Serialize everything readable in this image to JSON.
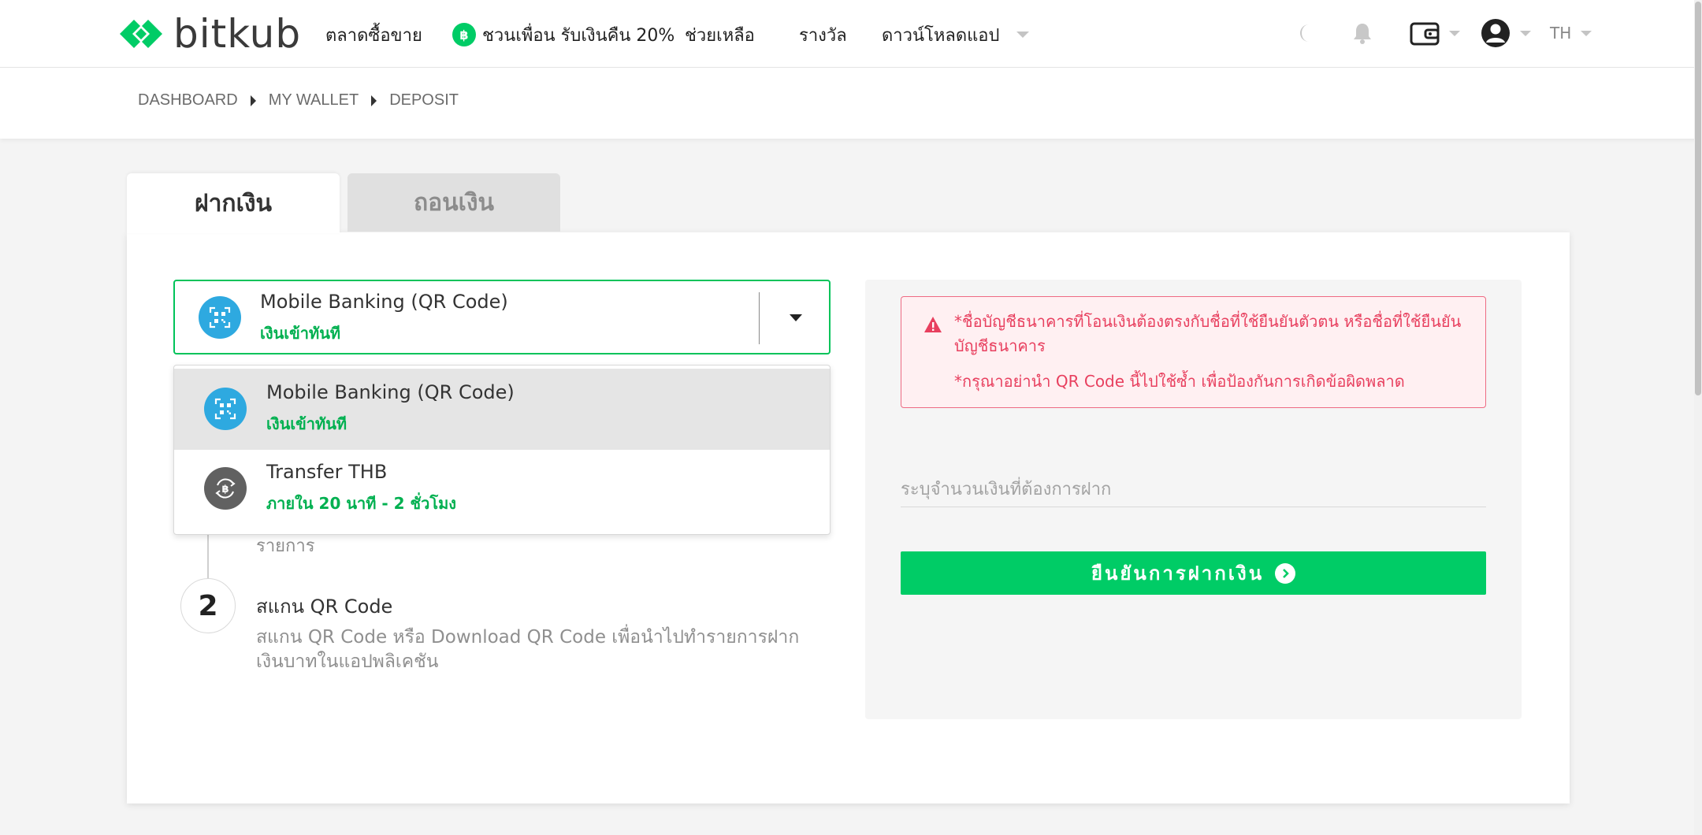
{
  "header": {
    "logo_text": "bitkub",
    "nav": {
      "market": "ตลาดซื้อขาย",
      "referral": "ชวนเพื่อน รับเงินคืน 20%",
      "help": "ช่วยเหลือ",
      "rewards": "รางวัล",
      "download": "ดาวน์โหลดแอป"
    },
    "language": "TH"
  },
  "breadcrumb": [
    "DASHBOARD",
    "MY WALLET",
    "DEPOSIT"
  ],
  "tabs": {
    "deposit": "ฝากเงิน",
    "withdraw": "ถอนเงิน"
  },
  "method_select": {
    "selected_title": "Mobile Banking (QR Code)",
    "selected_sub": "เงินเข้าทันที"
  },
  "dropdown": {
    "options": [
      {
        "title": "Mobile Banking (QR Code)",
        "sub": "เงินเข้าทันที",
        "icon": "qr-code-icon"
      },
      {
        "title": "Transfer THB",
        "sub": "ภายใน 20 นาที - 2 ชั่วโมง",
        "icon": "baht-transfer-icon"
      }
    ]
  },
  "steps": {
    "step1_tail": "รายการ",
    "step2": {
      "number": "2",
      "title": "สแกน QR Code",
      "desc": "สแกน QR Code หรือ Download QR Code เพื่อนำไปทำรายการฝากเงินบาทในแอปพลิเคชัน"
    }
  },
  "alert": {
    "line1": "*ชื่อบัญชีธนาคารที่โอนเงินต้องตรงกับชื่อที่ใช้ยืนยันตัวตน หรือชื่อที่ใช้ยืนยัน",
    "line2": "บัญชีธนาคาร",
    "line3": "*กรุณาอย่านำ QR Code นี้ไปใช้ซ้ำ เพื่อป้องกันการเกิดข้อผิดพลาด"
  },
  "amount": {
    "placeholder": "ระบุจำนวนเงินที่ต้องการฝาก"
  },
  "confirm_button": "ยืนยันการฝากเงิน",
  "colors": {
    "brand_green": "#00cc66",
    "select_border": "#00c35a",
    "qr_blue": "#2ea9e0",
    "alert_red": "#e8405f",
    "alert_bg": "#fff0f2"
  }
}
